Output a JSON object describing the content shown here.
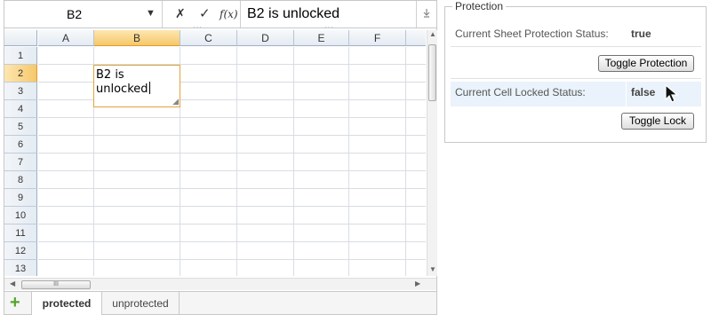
{
  "formula_bar": {
    "name_box": "B2",
    "cancel_icon": "✗",
    "confirm_icon": "✓",
    "fx_label": "f(x)",
    "formula_value": "B2 is unlocked"
  },
  "grid": {
    "columns": [
      "A",
      "B",
      "C",
      "D",
      "E",
      "F"
    ],
    "rows": [
      "1",
      "2",
      "3",
      "4",
      "5",
      "6",
      "7",
      "8",
      "9",
      "10",
      "11",
      "12",
      "13"
    ],
    "selected_column": "B",
    "selected_row": "2",
    "active_cell_text": "B2 is unlocked"
  },
  "scroll": {
    "hthumb_grip": "III"
  },
  "sheet_tabs": {
    "add_icon": "+",
    "tabs": [
      "protected",
      "unprotected"
    ],
    "active_tab": "protected"
  },
  "protection_panel": {
    "legend": "Protection",
    "sheet_status_label": "Current Sheet Protection Status:",
    "sheet_status_value": "true",
    "toggle_protection_label": "Toggle Protection",
    "cell_status_label": "Current Cell Locked Status:",
    "cell_status_value": "false",
    "toggle_lock_label": "Toggle Lock"
  },
  "icons": {
    "name_box_dropdown": "chevron-down-icon",
    "expand": "expand-formula-icon",
    "add_sheet": "plus-icon",
    "cursor": "mouse-pointer-icon"
  },
  "colors": {
    "selected_header": "#f6c86a",
    "active_cell_border": "#e0a53b",
    "add_sheet": "#55a630",
    "highlight_row": "#eaf3fb"
  }
}
